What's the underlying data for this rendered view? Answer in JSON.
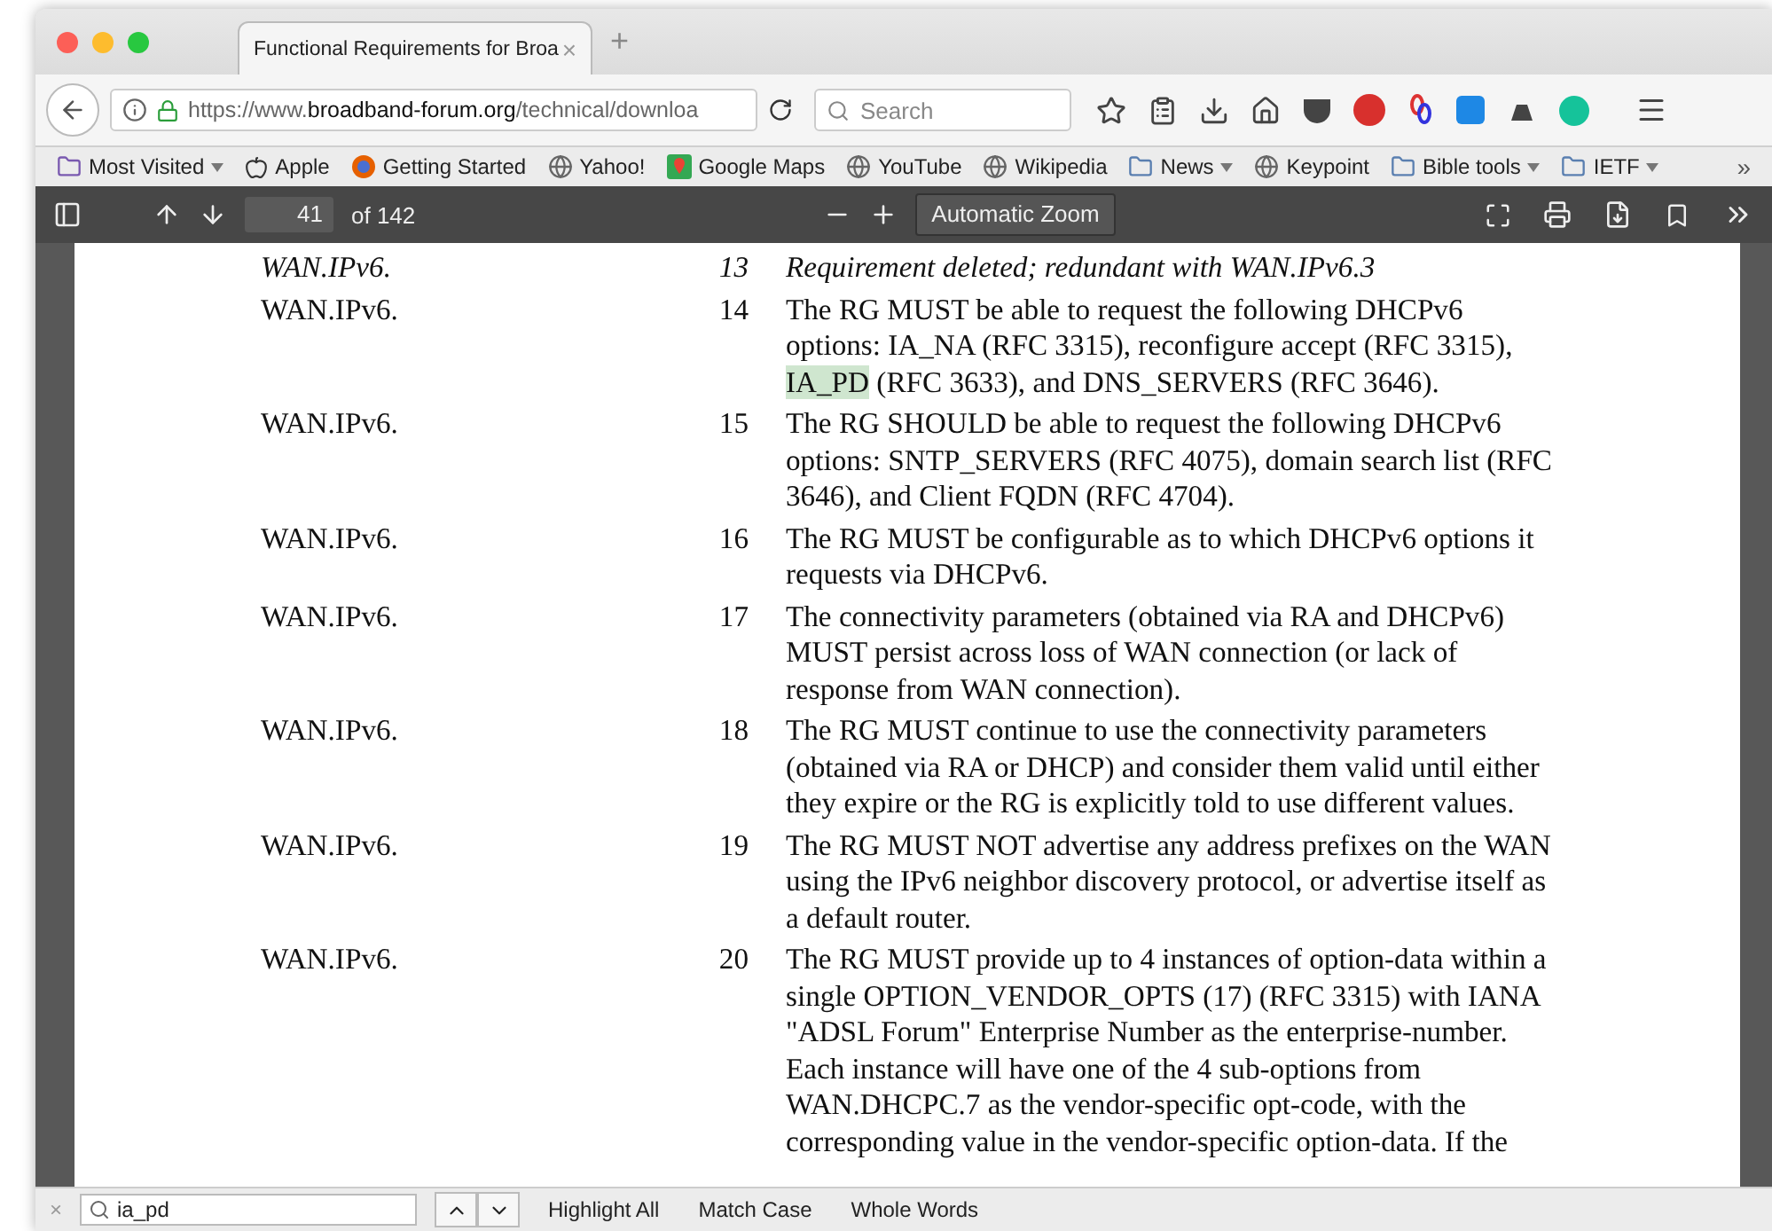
{
  "tabs": [
    {
      "title": "Functional Requirements for Broa",
      "selected": true,
      "close": "×"
    }
  ],
  "new_tab": "+",
  "navbar": {
    "url": {
      "prefix": "https://www.",
      "domain": "broadband-forum.org",
      "path": "/technical/downloa"
    },
    "search": {
      "placeholder": "Search"
    }
  },
  "bookmarks": [
    {
      "label": "Most Visited",
      "menu": true
    },
    {
      "label": "Apple",
      "menu": false
    },
    {
      "label": "Getting Started",
      "menu": false
    },
    {
      "label": "Yahoo!",
      "menu": false
    },
    {
      "label": "Google Maps",
      "menu": false
    },
    {
      "label": "YouTube",
      "menu": false
    },
    {
      "label": "Wikipedia",
      "menu": false
    },
    {
      "label": "News",
      "menu": true
    },
    {
      "label": "Keypoint",
      "menu": false
    },
    {
      "label": "Bible tools",
      "menu": true
    },
    {
      "label": "IETF",
      "menu": true
    }
  ],
  "bookmarks_overflow": "»",
  "pdf_toolbar": {
    "page": "41",
    "page_count": "of 142",
    "zoom": "Automatic Zoom"
  },
  "requirements": [
    {
      "id": "WAN.IPv6.",
      "number": "13",
      "italic": true,
      "lines": [
        "Requirement deleted; redundant with WAN.IPv6.3"
      ]
    },
    {
      "id": "WAN.IPv6.",
      "number": "14",
      "italic": false,
      "lines": [
        "The RG MUST be able to request the following DHCPv6",
        "options: IA_NA (RFC 3315), reconfigure accept (RFC 3315),",
        {
          "segments": [
            {
              "text": "IA_PD",
              "match": true
            },
            {
              "text": " (RFC 3633), and DNS_SERVERS (RFC 3646).",
              "match": false
            }
          ]
        }
      ]
    },
    {
      "id": "WAN.IPv6.",
      "number": "15",
      "italic": false,
      "lines": [
        "The RG SHOULD be able to request the following DHCPv6",
        "options: SNTP_SERVERS (RFC 4075), domain search list (RFC",
        "3646), and Client FQDN (RFC 4704)."
      ]
    },
    {
      "id": "WAN.IPv6.",
      "number": "16",
      "italic": false,
      "lines": [
        "The RG MUST be configurable as to which DHCPv6 options it",
        "requests via DHCPv6."
      ]
    },
    {
      "id": "WAN.IPv6.",
      "number": "17",
      "italic": false,
      "lines": [
        "The connectivity parameters (obtained via RA and DHCPv6)",
        "MUST persist across loss of WAN connection (or lack of",
        "response from WAN connection)."
      ]
    },
    {
      "id": "WAN.IPv6.",
      "number": "18",
      "italic": false,
      "lines": [
        "The RG MUST continue to use the connectivity parameters",
        "(obtained via RA or DHCP) and consider them valid until either",
        "they expire or the RG is explicitly told to use different values."
      ]
    },
    {
      "id": "WAN.IPv6.",
      "number": "19",
      "italic": false,
      "lines": [
        "The RG MUST NOT advertise any address prefixes on the WAN",
        "using the IPv6 neighbor discovery protocol, or advertise itself as",
        "a default router."
      ]
    },
    {
      "id": "WAN.IPv6.",
      "number": "20",
      "italic": false,
      "lines": [
        "The RG MUST provide up to 4 instances of option-data within a",
        "single OPTION_VENDOR_OPTS (17) (RFC 3315) with IANA",
        "\"ADSL Forum\" Enterprise Number as the enterprise-number.",
        "Each instance will have one of the 4 sub-options from",
        "WAN.DHCPC.7 as the vendor-specific opt-code, with the",
        "corresponding value in the vendor-specific option-data. If the"
      ]
    }
  ],
  "findbar": {
    "close": "×",
    "query": "ia_pd",
    "options": [
      {
        "label": "Highlight All",
        "checked": false
      },
      {
        "label": "Match Case",
        "checked": false
      },
      {
        "label": "Whole Words",
        "checked": false
      }
    ]
  }
}
